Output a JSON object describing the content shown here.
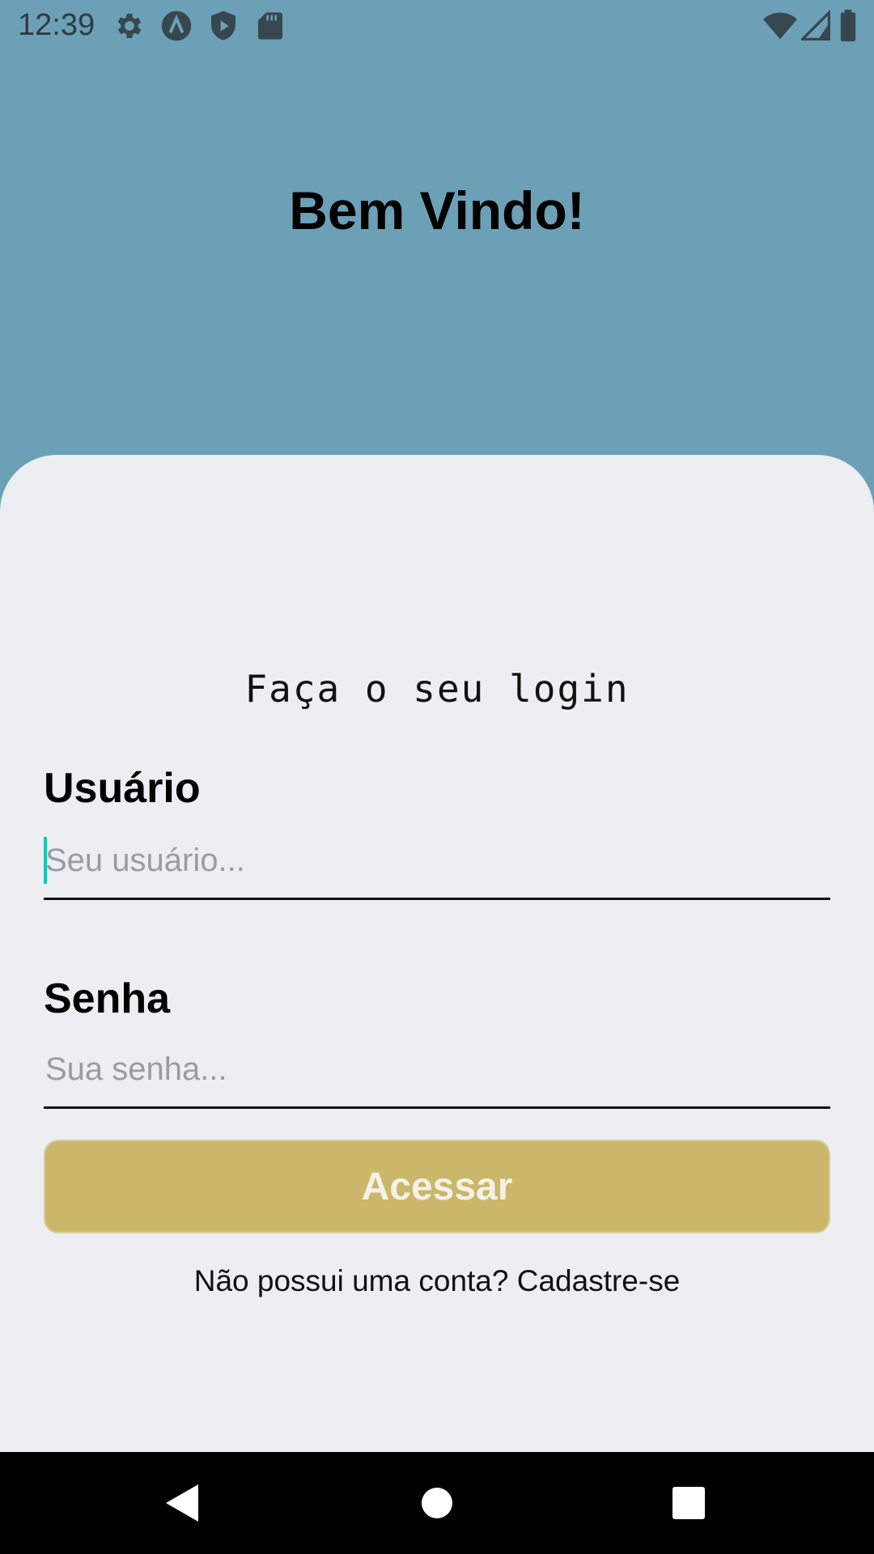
{
  "status_bar": {
    "time": "12:39",
    "left_icons": [
      "settings-icon",
      "app-a-icon",
      "shield-play-icon",
      "sd-card-icon"
    ],
    "right_icons": [
      "wifi-icon",
      "cell-signal-icon",
      "battery-icon"
    ]
  },
  "header": {
    "title": "Bem Vindo!"
  },
  "login": {
    "subtitle": "Faça o seu login",
    "username": {
      "label": "Usuário",
      "placeholder": "Seu usuário...",
      "value": ""
    },
    "password": {
      "label": "Senha",
      "placeholder": "Sua senha...",
      "value": ""
    },
    "submit_label": "Acessar",
    "signup_prompt": "Não possui uma conta?",
    "signup_link": "Cadastre-se"
  },
  "nav_bar": {
    "buttons": [
      "back-icon",
      "home-icon",
      "recents-icon"
    ]
  },
  "colors": {
    "header_bg": "#6ca0b6",
    "card_bg": "#eceef1",
    "button_bg": "#cbb769",
    "cursor": "#18c5b0"
  }
}
